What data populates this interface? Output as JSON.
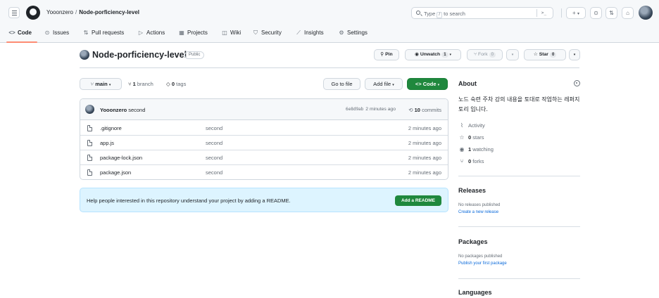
{
  "header": {
    "owner": "Yooonzero",
    "separator": "/",
    "repo": "Node-porficiency-level",
    "search_placeholder_prefix": "Type",
    "search_key": "/",
    "search_placeholder_suffix": "to search",
    "command_palette_label": ">_",
    "new_label": "+",
    "new_caret": "▾"
  },
  "nav": {
    "tabs": [
      {
        "label": "Code",
        "icon": "code-icon"
      },
      {
        "label": "Issues",
        "icon": "issue-icon"
      },
      {
        "label": "Pull requests",
        "icon": "pull-request-icon"
      },
      {
        "label": "Actions",
        "icon": "play-icon"
      },
      {
        "label": "Projects",
        "icon": "table-icon"
      },
      {
        "label": "Wiki",
        "icon": "book-icon"
      },
      {
        "label": "Security",
        "icon": "shield-icon"
      },
      {
        "label": "Insights",
        "icon": "graph-icon"
      },
      {
        "label": "Settings",
        "icon": "gear-icon"
      }
    ]
  },
  "repo": {
    "title": "Node-porficiency-level",
    "visibility": "Public",
    "pin_label": "Pin",
    "watch_label": "Unwatch",
    "watch_count": "1",
    "fork_label": "Fork",
    "fork_count": "0",
    "star_label": "Star",
    "star_count": "0"
  },
  "branch_bar": {
    "branch": "main",
    "branch_count": "1",
    "branch_word": "branch",
    "tag_count": "0",
    "tag_word": "tags",
    "go_to_file": "Go to file",
    "add_file": "Add file",
    "code_button": "Code"
  },
  "commit": {
    "author": "Yooonzero",
    "message": "second",
    "sha": "6e8d9ab",
    "time": "2 minutes ago",
    "commit_count": "10",
    "commit_word": "commits"
  },
  "files": [
    {
      "name": ".gitignore",
      "message": "second",
      "time": "2 minutes ago"
    },
    {
      "name": "app.js",
      "message": "second",
      "time": "2 minutes ago"
    },
    {
      "name": "package-lock.json",
      "message": "second",
      "time": "2 minutes ago"
    },
    {
      "name": "package.json",
      "message": "second",
      "time": "2 minutes ago"
    }
  ],
  "readme_banner": {
    "text": "Help people interested in this repository understand your project by adding a README.",
    "button": "Add a README"
  },
  "about": {
    "heading": "About",
    "description": "노드 숙련 주차 강의 내용을 토대로 작업하는 레퍼지토리 입니다.",
    "activity": "Activity",
    "stars_count": "0",
    "stars_word": "stars",
    "watching_count": "1",
    "watching_word": "watching",
    "forks_count": "0",
    "forks_word": "forks"
  },
  "releases": {
    "heading": "Releases",
    "empty": "No releases published",
    "link": "Create a new release"
  },
  "packages": {
    "heading": "Packages",
    "empty": "No packages published",
    "link": "Publish your first package"
  },
  "languages": {
    "heading": "Languages"
  },
  "colors": {
    "accent_green": "#1f883d",
    "link_blue": "#0969da",
    "tab_underline": "#fd8c73",
    "banner_bg": "#ddf4ff"
  }
}
